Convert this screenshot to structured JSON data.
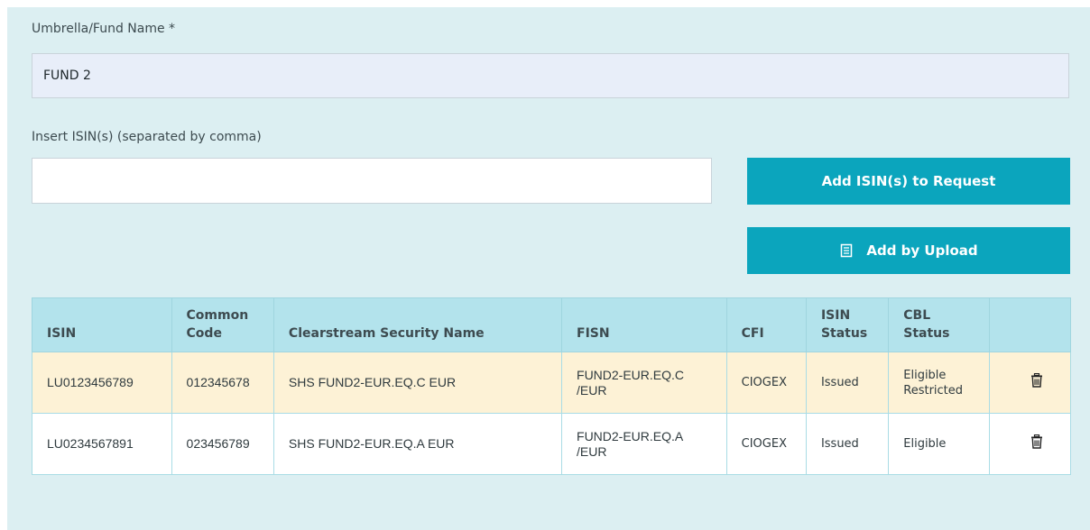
{
  "form": {
    "fund_label": "Umbrella/Fund Name *",
    "fund_value": "FUND 2",
    "isin_label": "Insert ISIN(s) (separated by comma)",
    "isin_value": "",
    "add_button": "Add ISIN(s) to Request",
    "upload_button": "Add by Upload",
    "upload_icon": "document-icon"
  },
  "table": {
    "headers": {
      "isin": "ISIN",
      "common_code_1": "Common",
      "common_code_2": "Code",
      "security_name": "Clearstream Security Name",
      "fisn": "FISN",
      "cfi": "CFI",
      "isin_status_1": "ISIN",
      "isin_status_2": "Status",
      "cbl_status_1": "CBL",
      "cbl_status_2": "Status"
    },
    "rows": [
      {
        "isin": "LU0123456789",
        "common_code": "012345678",
        "security_name": "SHS FUND2-EUR.EQ.C EUR",
        "fisn_1": "FUND2-EUR.EQ.C",
        "fisn_2": "/EUR",
        "cfi": "CIOGEX",
        "isin_status": "Issued",
        "cbl_status_1": "Eligible",
        "cbl_status_2": "Restricted",
        "delete_icon": "trash-icon"
      },
      {
        "isin": "LU0234567891",
        "common_code": "023456789",
        "security_name": "SHS FUND2-EUR.EQ.A EUR",
        "fisn_1": "FUND2-EUR.EQ.A",
        "fisn_2": "/EUR",
        "cfi": "CIOGEX",
        "isin_status": "Issued",
        "cbl_status_1": "Eligible",
        "cbl_status_2": "",
        "delete_icon": "trash-icon"
      }
    ]
  },
  "colors": {
    "panel_bg": "#dceff2",
    "button_bg": "#0ba5bd",
    "header_bg": "#b3e3ec",
    "highlight_row": "#fdf2d6"
  }
}
